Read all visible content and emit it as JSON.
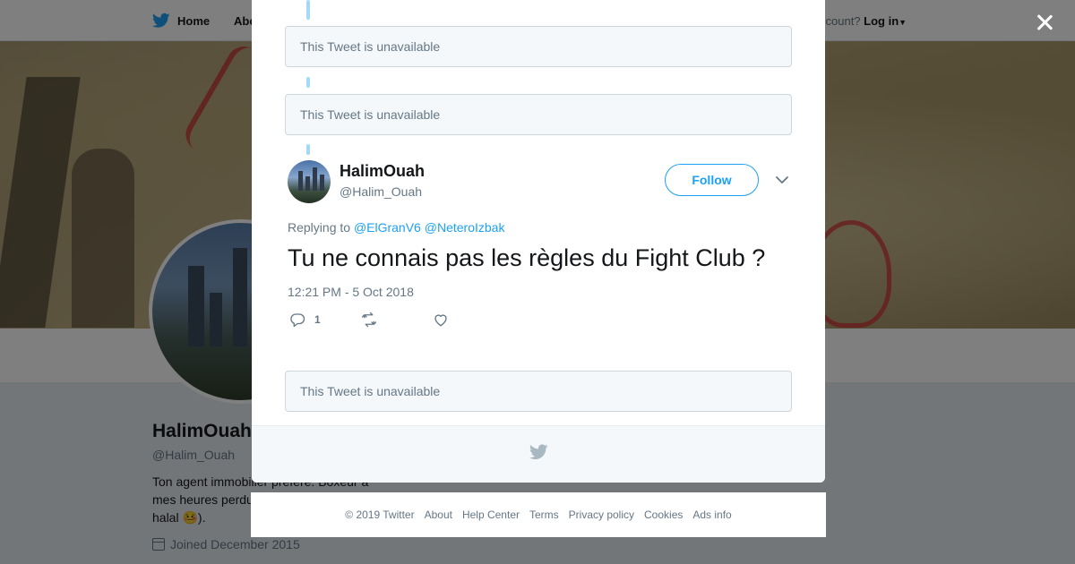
{
  "topbar": {
    "home_label": "Home",
    "about_label": "Abo",
    "account_text": "ccount?",
    "login_label": "Log in"
  },
  "profile": {
    "name": "HalimOuah",
    "handle": "@Halim_Ouah",
    "bio": "Ton agent immobilier préféré. Boxeur à mes heures perdu",
    "bio_end": "halal 🤒).",
    "joined": "Joined December 2015",
    "ads_fragment": "Ads info"
  },
  "modal": {
    "unavailable_1": "This Tweet is unavailable",
    "unavailable_2": "This Tweet is unavailable",
    "unavailable_3": "This Tweet is unavailable",
    "tweet": {
      "author_name": "HalimOuah",
      "author_handle": "@Halim_Ouah",
      "follow_label": "Follow",
      "replying_prefix": "Replying to",
      "mention_1": "@ElGranV6",
      "mention_2": "@NeteroIzbak",
      "text": "Tu ne connais pas les règles du Fight Club ?",
      "timestamp": "12:21 PM - 5 Oct 2018",
      "reply_count": "1"
    }
  },
  "footer": {
    "copyright": "© 2019 Twitter",
    "about": "About",
    "help": "Help Center",
    "terms": "Terms",
    "privacy": "Privacy policy",
    "cookies": "Cookies",
    "ads": "Ads info"
  },
  "colors": {
    "brand": "#1da1f2",
    "thread_line": "#a4d9f5",
    "text_secondary": "#657786"
  }
}
